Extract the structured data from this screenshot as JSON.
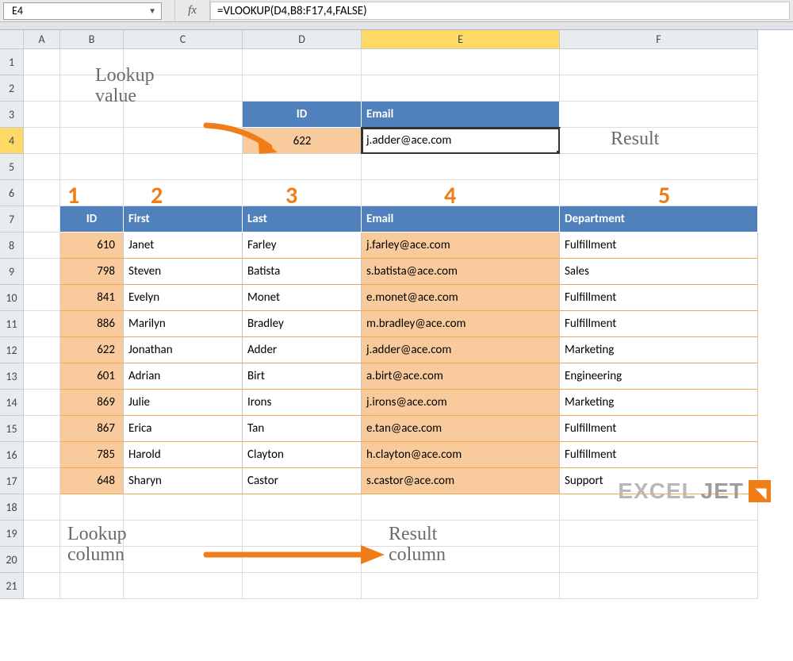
{
  "namebox": "E4",
  "formula": "=VLOOKUP(D4,B8:F17,4,FALSE)",
  "fx_label": "fx",
  "columns": [
    "A",
    "B",
    "C",
    "D",
    "E",
    "F"
  ],
  "active_col": "E",
  "active_row": "4",
  "row_count": 21,
  "lookup_box": {
    "header_id": "ID",
    "header_email": "Email",
    "id_value": "622",
    "email_value": "j.adder@ace.com"
  },
  "col_numbers": [
    "1",
    "2",
    "3",
    "4",
    "5"
  ],
  "table": {
    "headers": [
      "ID",
      "First",
      "Last",
      "Email",
      "Department"
    ],
    "rows": [
      {
        "id": "610",
        "first": "Janet",
        "last": "Farley",
        "email": "j.farley@ace.com",
        "dept": "Fulfillment"
      },
      {
        "id": "798",
        "first": "Steven",
        "last": "Batista",
        "email": "s.batista@ace.com",
        "dept": "Sales"
      },
      {
        "id": "841",
        "first": "Evelyn",
        "last": "Monet",
        "email": "e.monet@ace.com",
        "dept": "Fulfillment"
      },
      {
        "id": "886",
        "first": "Marilyn",
        "last": "Bradley",
        "email": "m.bradley@ace.com",
        "dept": "Fulfillment"
      },
      {
        "id": "622",
        "first": "Jonathan",
        "last": "Adder",
        "email": "j.adder@ace.com",
        "dept": "Marketing"
      },
      {
        "id": "601",
        "first": "Adrian",
        "last": "Birt",
        "email": "a.birt@ace.com",
        "dept": "Engineering"
      },
      {
        "id": "869",
        "first": "Julie",
        "last": "Irons",
        "email": "j.irons@ace.com",
        "dept": "Marketing"
      },
      {
        "id": "867",
        "first": "Erica",
        "last": "Tan",
        "email": "e.tan@ace.com",
        "dept": "Fulfillment"
      },
      {
        "id": "785",
        "first": "Harold",
        "last": "Clayton",
        "email": "h.clayton@ace.com",
        "dept": "Fulfillment"
      },
      {
        "id": "648",
        "first": "Sharyn",
        "last": "Castor",
        "email": "s.castor@ace.com",
        "dept": "Support"
      }
    ]
  },
  "annotations": {
    "lookup_value": "Lookup\nvalue",
    "result": "Result",
    "lookup_column": "Lookup\ncolumn",
    "result_column": "Result\ncolumn"
  },
  "logo": {
    "part1": "EXCEL",
    "part2": "JET"
  },
  "colors": {
    "header_bg": "#5081bd",
    "highlight": "#f9cb9c",
    "accent": "#f07d18"
  }
}
